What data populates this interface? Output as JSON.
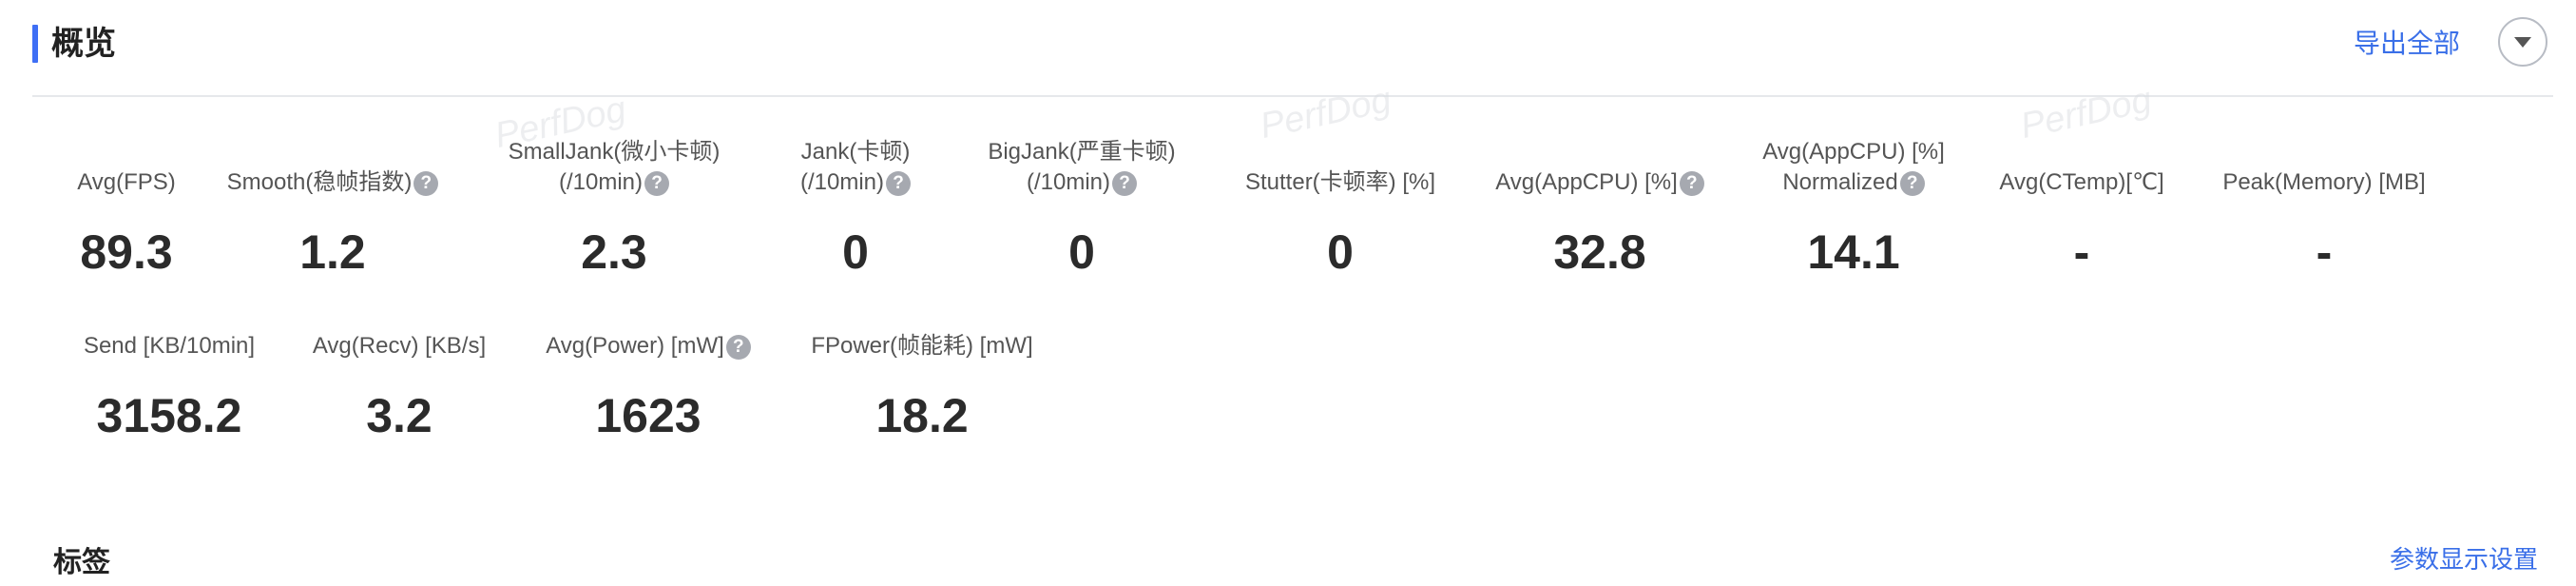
{
  "header": {
    "title": "概览",
    "export_label": "导出全部",
    "collapse_icon": "chevron-down-icon"
  },
  "watermark": "PerfDog",
  "metrics_row1": [
    {
      "label_lines": [
        "Avg(FPS)"
      ],
      "help": false,
      "value": "89.3"
    },
    {
      "label_lines": [
        "Smooth(稳帧指数)"
      ],
      "help": true,
      "value": "1.2"
    },
    {
      "label_lines": [
        "SmallJank(微小卡顿)",
        "(/10min)"
      ],
      "help": true,
      "value": "2.3"
    },
    {
      "label_lines": [
        "Jank(卡顿)",
        "(/10min)"
      ],
      "help": true,
      "value": "0"
    },
    {
      "label_lines": [
        "BigJank(严重卡顿)",
        "(/10min)"
      ],
      "help": true,
      "value": "0"
    },
    {
      "label_lines": [
        "Stutter(卡顿率) [%]"
      ],
      "help": false,
      "value": "0"
    },
    {
      "label_lines": [
        "Avg(AppCPU) [%]"
      ],
      "help": true,
      "value": "32.8"
    },
    {
      "label_lines": [
        "Avg(AppCPU) [%]",
        "Normalized"
      ],
      "help": true,
      "value": "14.1"
    },
    {
      "label_lines": [
        "Avg(CTemp)[℃]"
      ],
      "help": false,
      "value": "-"
    },
    {
      "label_lines": [
        "Peak(Memory) [MB]"
      ],
      "help": false,
      "value": "-"
    }
  ],
  "metrics_row2": [
    {
      "label_lines": [
        "Send [KB/10min]"
      ],
      "help": false,
      "value": "3158.2"
    },
    {
      "label_lines": [
        "Avg(Recv) [KB/s]"
      ],
      "help": false,
      "value": "3.2"
    },
    {
      "label_lines": [
        "Avg(Power) [mW]"
      ],
      "help": true,
      "value": "1623"
    },
    {
      "label_lines": [
        "FPower(帧能耗) [mW]"
      ],
      "help": false,
      "value": "18.2"
    }
  ],
  "tags": {
    "title": "标签",
    "params_label": "参数显示设置"
  }
}
